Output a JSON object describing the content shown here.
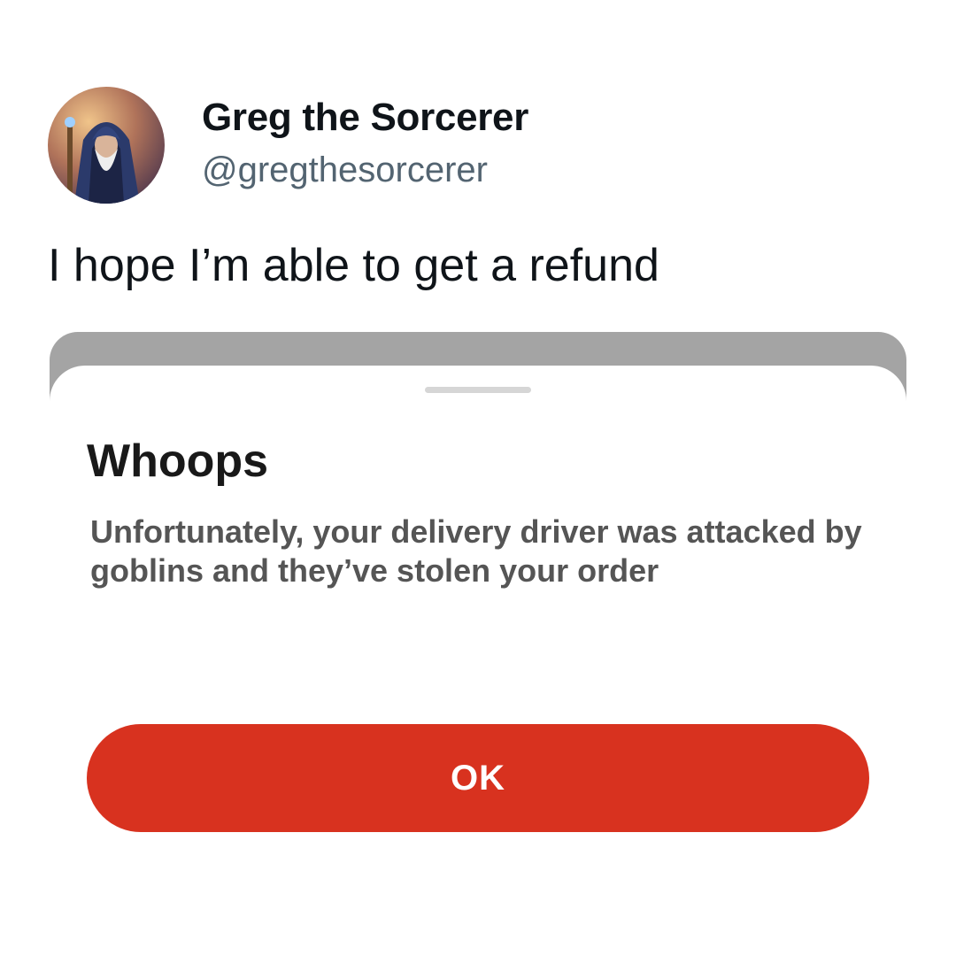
{
  "tweet": {
    "display_name": "Greg the Sorcerer",
    "handle": "@gregthesorcerer",
    "text": "I hope I’m able to get a refund",
    "avatar_icon": "wizard-avatar"
  },
  "dialog": {
    "title": "Whoops",
    "message": "Unfortunately, your delivery driver was attacked by goblins and they’ve stolen your order",
    "ok_label": "OK",
    "button_color": "#d8321f"
  }
}
